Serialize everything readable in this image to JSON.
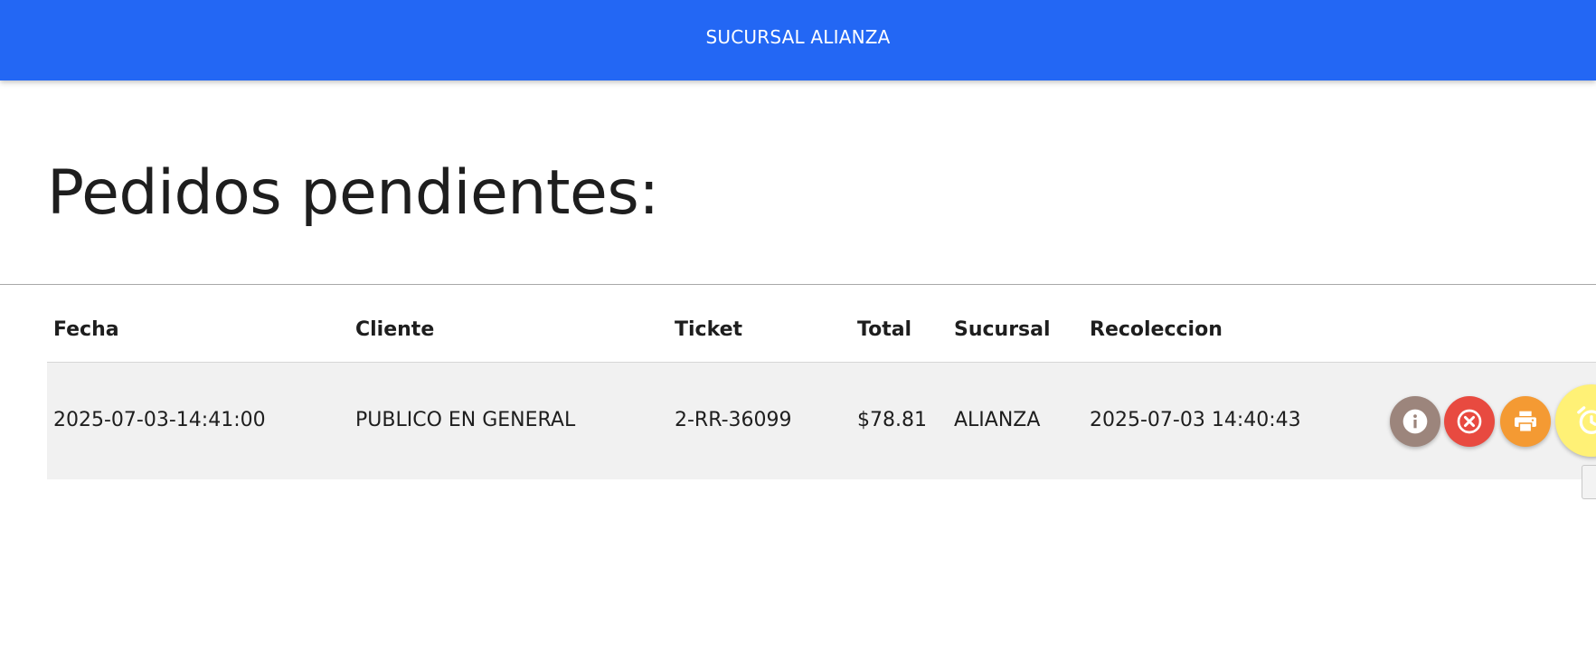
{
  "header": {
    "title": "SUCURSAL ALIANZA",
    "background": "#2367f4"
  },
  "page": {
    "title": "Pedidos pendientes:"
  },
  "table": {
    "columns": [
      "Fecha",
      "Cliente",
      "Ticket",
      "Total",
      "Sucursal",
      "Recoleccion"
    ],
    "rows": [
      {
        "fecha": "2025-07-03-14:41:00",
        "cliente": "PUBLICO EN GENERAL",
        "ticket": "2-RR-36099",
        "total": "$78.81",
        "sucursal": "ALIANZA",
        "recoleccion": "2025-07-03 14:40:43",
        "actions": [
          {
            "name": "info",
            "icon": "info-icon",
            "color": "#9c857c"
          },
          {
            "name": "cancel",
            "icon": "close-circle-icon",
            "color": "#e84a40"
          },
          {
            "name": "print",
            "icon": "printer-icon",
            "color": "#f49a33"
          },
          {
            "name": "alarm",
            "icon": "alarm-clock-icon",
            "color": "#fff176"
          }
        ]
      }
    ]
  }
}
